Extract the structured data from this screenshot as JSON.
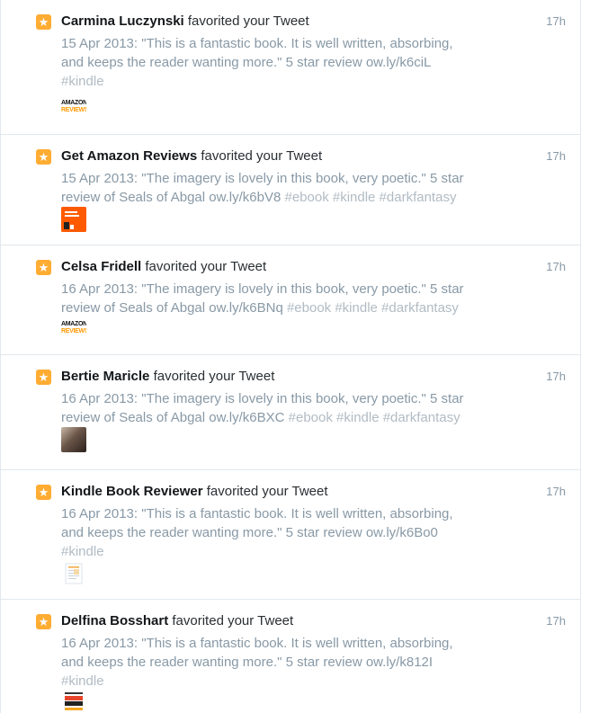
{
  "notifications": [
    {
      "name": "Carmina Luczynski",
      "action": "favorited your Tweet",
      "time": "17h",
      "line1": "15 Apr 2013: \"This is a fantastic book. It is well written, absorbing,",
      "line2": "and keeps the reader wanting more.\" 5 star review ow.ly/k6ciL",
      "line3_tags": "#kindle",
      "avatar_icon": "amazon-reviews-logo",
      "logo_top": "AMAZON",
      "logo_bottom": "REVIEWS"
    },
    {
      "name": "Get Amazon Reviews",
      "action": "favorited your Tweet",
      "time": "17h",
      "line1": "15 Apr 2013: \"The imagery is lovely in this book, very poetic.\" 5 star",
      "line2": "review of Seals of Abgal ow.ly/k6bV8",
      "line2_tags": " #ebook #kindle #darkfantasy",
      "avatar_icon": "book-review-logo"
    },
    {
      "name": "Celsa Fridell",
      "action": "favorited your Tweet",
      "time": "17h",
      "line1": "16 Apr 2013: \"The imagery is lovely in this book, very poetic.\" 5 star",
      "line2": "review of Seals of Abgal ow.ly/k6BNq",
      "line2_tags": " #ebook #kindle #darkfantasy",
      "avatar_icon": "amazon-reviews-logo",
      "logo_top": "AMAZON",
      "logo_bottom": "REVIEWS"
    },
    {
      "name": "Bertie Maricle",
      "action": "favorited your Tweet",
      "time": "17h",
      "line1": "16 Apr 2013: \"The imagery is lovely in this book, very poetic.\" 5 star",
      "line2": "review of Seals of Abgal ow.ly/k6BXC",
      "line2_tags": " #ebook #kindle #darkfantasy",
      "avatar_icon": "profile-photo"
    },
    {
      "name": "Kindle Book Reviewer",
      "action": "favorited your Tweet",
      "time": "17h",
      "line1": "16 Apr 2013: \"This is a fantastic book. It is well written, absorbing,",
      "line2": "and keeps the reader wanting more.\" 5 star review ow.ly/k6Bo0",
      "line3_tags": "#kindle",
      "avatar_icon": "document-logo"
    },
    {
      "name": "Delfina Bosshart",
      "action": "favorited your Tweet",
      "time": "17h",
      "line1": "16 Apr 2013: \"This is a fantastic book. It is well written, absorbing,",
      "line2": "and keeps the reader wanting more.\" 5 star review ow.ly/k812I",
      "line3_tags": "#kindle",
      "avatar_icon": "five-star-reviews-logo"
    }
  ],
  "colors": {
    "star_badge": "#ffac33",
    "muted_text": "#8899a6",
    "hashtag": "#b1bbc4",
    "divider": "#e1e8ed"
  }
}
